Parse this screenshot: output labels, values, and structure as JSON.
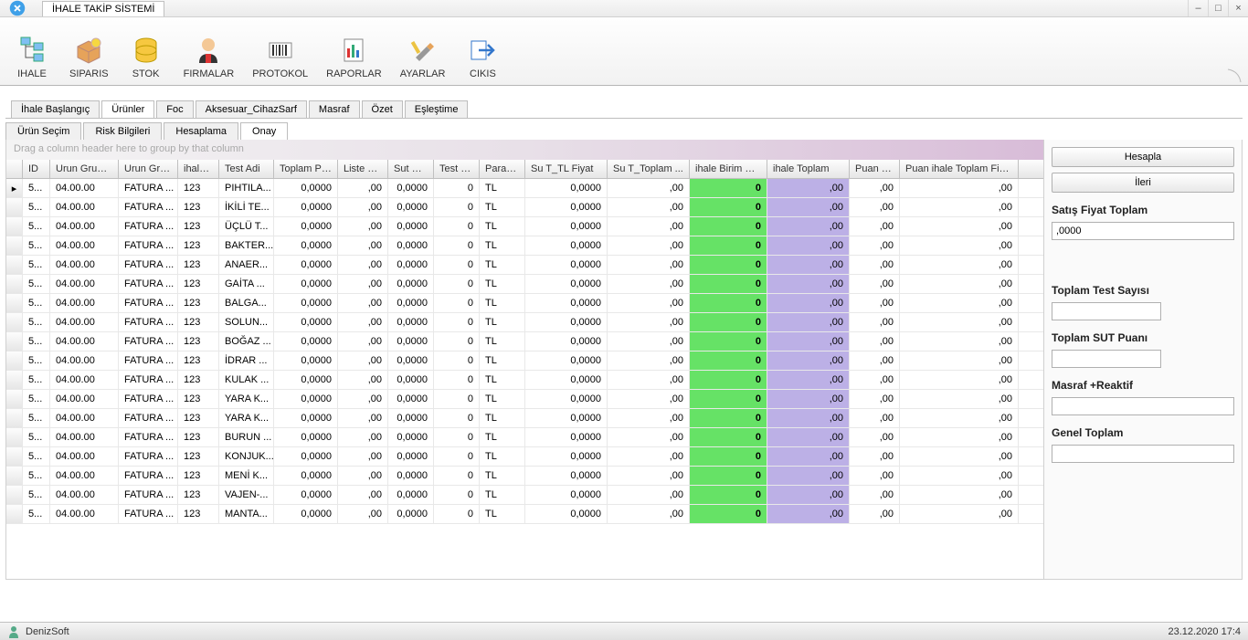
{
  "app": {
    "title": "İHALE TAKİP SİSTEMİ"
  },
  "sysControls": {
    "minimize": "–",
    "maximize": "□",
    "close": "×",
    "tray": "‒"
  },
  "ribbon": [
    {
      "key": "ihale",
      "label": "IHALE"
    },
    {
      "key": "siparis",
      "label": "SIPARIS"
    },
    {
      "key": "stok",
      "label": "STOK"
    },
    {
      "key": "firmalar",
      "label": "FIRMALAR"
    },
    {
      "key": "protokol",
      "label": "PROTOKOL"
    },
    {
      "key": "raporlar",
      "label": "RAPORLAR"
    },
    {
      "key": "ayarlar",
      "label": "AYARLAR"
    },
    {
      "key": "cikis",
      "label": "CIKIS"
    }
  ],
  "tabs": {
    "main": [
      {
        "label": "İhale Başlangıç",
        "active": false
      },
      {
        "label": "Ürünler",
        "active": true
      },
      {
        "label": "Foc",
        "active": false
      },
      {
        "label": "Aksesuar_CihazSarf",
        "active": false
      },
      {
        "label": "Masraf",
        "active": false
      },
      {
        "label": "Özet",
        "active": false
      },
      {
        "label": "Eşleştime",
        "active": false
      }
    ],
    "sub": [
      {
        "label": "Ürün Seçim",
        "active": false
      },
      {
        "label": "Risk Bilgileri",
        "active": false
      },
      {
        "label": "Hesaplama",
        "active": false
      },
      {
        "label": "Onay",
        "active": true
      }
    ]
  },
  "grid": {
    "groupBarText": "Drag a column header here to group by that column",
    "columns": [
      "",
      "ID",
      "Urun Grup ...",
      "Urun Gru...",
      "ihale ...",
      "Test Adi",
      "Toplam Puan",
      "Liste Fi...",
      "Sut Pu...",
      "Test S...",
      "Para B...",
      "Su T_TL Fiyat",
      "Su T_Toplam ...",
      "ihale Birim Fiyati",
      "ihale Toplam",
      "Puan ih...",
      "Puan ihale Toplam Fiyat"
    ],
    "rows": [
      {
        "marker": "▸",
        "id": "5...",
        "grup": "04.00.00",
        "grupad": "FATURA ...",
        "ihale": "123",
        "test": "PIHTILA...",
        "tp": "0,0000",
        "lf": ",00",
        "sp": "0,0000",
        "ts": "0",
        "pb": "TL",
        "sutl": "0,0000",
        "sutop": ",00",
        "ibf": "0",
        "it": ",00",
        "pih": ",00",
        "piht": ",00"
      },
      {
        "marker": "",
        "id": "5...",
        "grup": "04.00.00",
        "grupad": "FATURA ...",
        "ihale": "123",
        "test": "İKİLİ TE...",
        "tp": "0,0000",
        "lf": ",00",
        "sp": "0,0000",
        "ts": "0",
        "pb": "TL",
        "sutl": "0,0000",
        "sutop": ",00",
        "ibf": "0",
        "it": ",00",
        "pih": ",00",
        "piht": ",00"
      },
      {
        "marker": "",
        "id": "5...",
        "grup": "04.00.00",
        "grupad": "FATURA ...",
        "ihale": "123",
        "test": "ÜÇLÜ T...",
        "tp": "0,0000",
        "lf": ",00",
        "sp": "0,0000",
        "ts": "0",
        "pb": "TL",
        "sutl": "0,0000",
        "sutop": ",00",
        "ibf": "0",
        "it": ",00",
        "pih": ",00",
        "piht": ",00"
      },
      {
        "marker": "",
        "id": "5...",
        "grup": "04.00.00",
        "grupad": "FATURA ...",
        "ihale": "123",
        "test": "BAKTER...",
        "tp": "0,0000",
        "lf": ",00",
        "sp": "0,0000",
        "ts": "0",
        "pb": "TL",
        "sutl": "0,0000",
        "sutop": ",00",
        "ibf": "0",
        "it": ",00",
        "pih": ",00",
        "piht": ",00"
      },
      {
        "marker": "",
        "id": "5...",
        "grup": "04.00.00",
        "grupad": "FATURA ...",
        "ihale": "123",
        "test": "ANAER...",
        "tp": "0,0000",
        "lf": ",00",
        "sp": "0,0000",
        "ts": "0",
        "pb": "TL",
        "sutl": "0,0000",
        "sutop": ",00",
        "ibf": "0",
        "it": ",00",
        "pih": ",00",
        "piht": ",00"
      },
      {
        "marker": "",
        "id": "5...",
        "grup": "04.00.00",
        "grupad": "FATURA ...",
        "ihale": "123",
        "test": "GAİTA ...",
        "tp": "0,0000",
        "lf": ",00",
        "sp": "0,0000",
        "ts": "0",
        "pb": "TL",
        "sutl": "0,0000",
        "sutop": ",00",
        "ibf": "0",
        "it": ",00",
        "pih": ",00",
        "piht": ",00"
      },
      {
        "marker": "",
        "id": "5...",
        "grup": "04.00.00",
        "grupad": "FATURA ...",
        "ihale": "123",
        "test": "BALGA...",
        "tp": "0,0000",
        "lf": ",00",
        "sp": "0,0000",
        "ts": "0",
        "pb": "TL",
        "sutl": "0,0000",
        "sutop": ",00",
        "ibf": "0",
        "it": ",00",
        "pih": ",00",
        "piht": ",00"
      },
      {
        "marker": "",
        "id": "5...",
        "grup": "04.00.00",
        "grupad": "FATURA ...",
        "ihale": "123",
        "test": "SOLUN...",
        "tp": "0,0000",
        "lf": ",00",
        "sp": "0,0000",
        "ts": "0",
        "pb": "TL",
        "sutl": "0,0000",
        "sutop": ",00",
        "ibf": "0",
        "it": ",00",
        "pih": ",00",
        "piht": ",00"
      },
      {
        "marker": "",
        "id": "5...",
        "grup": "04.00.00",
        "grupad": "FATURA ...",
        "ihale": "123",
        "test": "BOĞAZ ...",
        "tp": "0,0000",
        "lf": ",00",
        "sp": "0,0000",
        "ts": "0",
        "pb": "TL",
        "sutl": "0,0000",
        "sutop": ",00",
        "ibf": "0",
        "it": ",00",
        "pih": ",00",
        "piht": ",00"
      },
      {
        "marker": "",
        "id": "5...",
        "grup": "04.00.00",
        "grupad": "FATURA ...",
        "ihale": "123",
        "test": "İDRAR ...",
        "tp": "0,0000",
        "lf": ",00",
        "sp": "0,0000",
        "ts": "0",
        "pb": "TL",
        "sutl": "0,0000",
        "sutop": ",00",
        "ibf": "0",
        "it": ",00",
        "pih": ",00",
        "piht": ",00"
      },
      {
        "marker": "",
        "id": "5...",
        "grup": "04.00.00",
        "grupad": "FATURA ...",
        "ihale": "123",
        "test": "KULAK ...",
        "tp": "0,0000",
        "lf": ",00",
        "sp": "0,0000",
        "ts": "0",
        "pb": "TL",
        "sutl": "0,0000",
        "sutop": ",00",
        "ibf": "0",
        "it": ",00",
        "pih": ",00",
        "piht": ",00"
      },
      {
        "marker": "",
        "id": "5...",
        "grup": "04.00.00",
        "grupad": "FATURA ...",
        "ihale": "123",
        "test": "YARA K...",
        "tp": "0,0000",
        "lf": ",00",
        "sp": "0,0000",
        "ts": "0",
        "pb": "TL",
        "sutl": "0,0000",
        "sutop": ",00",
        "ibf": "0",
        "it": ",00",
        "pih": ",00",
        "piht": ",00"
      },
      {
        "marker": "",
        "id": "5...",
        "grup": "04.00.00",
        "grupad": "FATURA ...",
        "ihale": "123",
        "test": "YARA K...",
        "tp": "0,0000",
        "lf": ",00",
        "sp": "0,0000",
        "ts": "0",
        "pb": "TL",
        "sutl": "0,0000",
        "sutop": ",00",
        "ibf": "0",
        "it": ",00",
        "pih": ",00",
        "piht": ",00"
      },
      {
        "marker": "",
        "id": "5...",
        "grup": "04.00.00",
        "grupad": "FATURA ...",
        "ihale": "123",
        "test": "BURUN ...",
        "tp": "0,0000",
        "lf": ",00",
        "sp": "0,0000",
        "ts": "0",
        "pb": "TL",
        "sutl": "0,0000",
        "sutop": ",00",
        "ibf": "0",
        "it": ",00",
        "pih": ",00",
        "piht": ",00"
      },
      {
        "marker": "",
        "id": "5...",
        "grup": "04.00.00",
        "grupad": "FATURA ...",
        "ihale": "123",
        "test": "KONJUK...",
        "tp": "0,0000",
        "lf": ",00",
        "sp": "0,0000",
        "ts": "0",
        "pb": "TL",
        "sutl": "0,0000",
        "sutop": ",00",
        "ibf": "0",
        "it": ",00",
        "pih": ",00",
        "piht": ",00"
      },
      {
        "marker": "",
        "id": "5...",
        "grup": "04.00.00",
        "grupad": "FATURA ...",
        "ihale": "123",
        "test": "MENİ K...",
        "tp": "0,0000",
        "lf": ",00",
        "sp": "0,0000",
        "ts": "0",
        "pb": "TL",
        "sutl": "0,0000",
        "sutop": ",00",
        "ibf": "0",
        "it": ",00",
        "pih": ",00",
        "piht": ",00"
      },
      {
        "marker": "",
        "id": "5...",
        "grup": "04.00.00",
        "grupad": "FATURA ...",
        "ihale": "123",
        "test": "VAJEN-...",
        "tp": "0,0000",
        "lf": ",00",
        "sp": "0,0000",
        "ts": "0",
        "pb": "TL",
        "sutl": "0,0000",
        "sutop": ",00",
        "ibf": "0",
        "it": ",00",
        "pih": ",00",
        "piht": ",00"
      },
      {
        "marker": "",
        "id": "5...",
        "grup": "04.00.00",
        "grupad": "FATURA ...",
        "ihale": "123",
        "test": "MANTA...",
        "tp": "0,0000",
        "lf": ",00",
        "sp": "0,0000",
        "ts": "0",
        "pb": "TL",
        "sutl": "0,0000",
        "sutop": ",00",
        "ibf": "0",
        "it": ",00",
        "pih": ",00",
        "piht": ",00"
      }
    ]
  },
  "side": {
    "hesapla": "Hesapla",
    "ileri": "İleri",
    "satis_label": "Satış Fiyat Toplam",
    "satis_value": ",0000",
    "test_sayisi_label": "Toplam Test Sayısı",
    "test_sayisi_value": "",
    "sut_puan_label": "Toplam SUT Puanı",
    "sut_puan_value": "",
    "masraf_label": "Masraf +Reaktif",
    "masraf_value": "",
    "genel_label": "Genel Toplam",
    "genel_value": ""
  },
  "status": {
    "company": "DenizSoft",
    "datetime": "23.12.2020 17:4"
  }
}
